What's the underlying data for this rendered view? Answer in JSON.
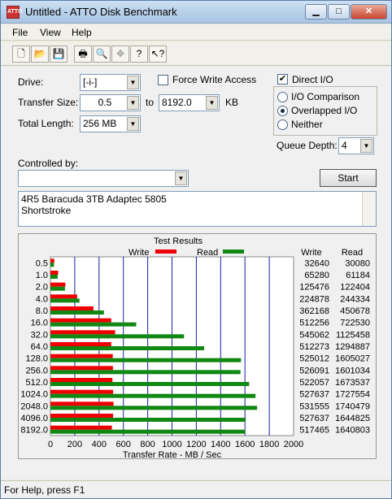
{
  "window": {
    "title": "Untitled - ATTO Disk Benchmark",
    "app_icon": "ATTO"
  },
  "menu": [
    "File",
    "View",
    "Help"
  ],
  "toolbar_icons": [
    "new-icon",
    "open-icon",
    "save-icon",
    "print-icon",
    "print-preview-icon",
    "move-icon",
    "help-icon",
    "context-help-icon"
  ],
  "form": {
    "drive_label": "Drive:",
    "drive_value": "[-i-]",
    "force_write_label": "Force Write Access",
    "force_write_checked": false,
    "direct_io_label": "Direct I/O",
    "direct_io_checked": true,
    "transfer_size_label": "Transfer Size:",
    "transfer_from": "0.5",
    "to_label": "to",
    "transfer_to": "8192.0",
    "kb_label": "KB",
    "total_length_label": "Total Length:",
    "total_length_value": "256 MB",
    "io_comparison_label": "I/O Comparison",
    "overlapped_io_label": "Overlapped I/O",
    "neither_label": "Neither",
    "io_mode_selected": "overlapped",
    "queue_depth_label": "Queue Depth:",
    "queue_depth_value": "4",
    "controlled_by_label": "Controlled by:",
    "controlled_by_value": "",
    "start_label": "Start",
    "description_line1": "4R5 Baracuda 3TB Adaptec 5805",
    "description_line2": "Shortstroke"
  },
  "status": "For Help, press F1",
  "chart_data": {
    "type": "bar",
    "title": "Test Results",
    "legend": [
      {
        "name": "Write",
        "color": "#ee0000"
      },
      {
        "name": "Read",
        "color": "#118811"
      }
    ],
    "legend_placement": "top",
    "xlabel": "Transfer Rate - MB / Sec",
    "xlim": [
      0,
      2000
    ],
    "xticks": [
      "0",
      "200",
      "400",
      "600",
      "800",
      "1000",
      "1200",
      "1400",
      "1600",
      "1800",
      "2000"
    ],
    "grid": true,
    "categories": [
      "0.5",
      "1.0",
      "2.0",
      "4.0",
      "8.0",
      "16.0",
      "32.0",
      "64.0",
      "128.0",
      "256.0",
      "512.0",
      "1024.0",
      "2048.0",
      "4096.0",
      "8192.0"
    ],
    "write_header": "Write",
    "read_header": "Read",
    "series": [
      {
        "name": "Write",
        "values": [
          32640,
          65280,
          125476,
          224878,
          362168,
          512256,
          545062,
          512273,
          525012,
          526091,
          522057,
          527637,
          531555,
          527637,
          517465
        ]
      },
      {
        "name": "Read",
        "values": [
          30080,
          61184,
          122404,
          244334,
          450678,
          722530,
          1125458,
          1294887,
          1605027,
          1601034,
          1673537,
          1727554,
          1740479,
          1644825,
          1640803
        ]
      }
    ]
  }
}
